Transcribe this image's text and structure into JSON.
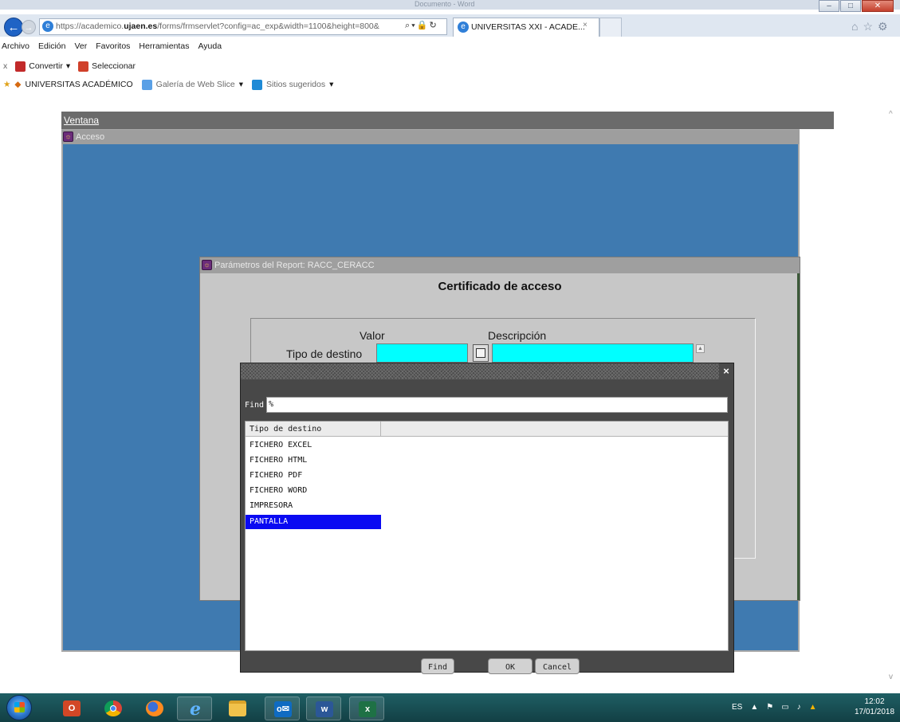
{
  "browser": {
    "title_faded": "Documento - Word",
    "address_url": "https://academico.ujaen.es/forms/frmservlet?config=ac_exp&width=1100&height=800&",
    "address_domain": "ujaen.es",
    "tab_title": "UNIVERSITAS XXI - ACADE...",
    "tab_close": "×",
    "menu": [
      "Archivo",
      "Edición",
      "Ver",
      "Favoritos",
      "Herramientas",
      "Ayuda"
    ],
    "toolbar": {
      "close_x": "x",
      "convert_label": "Convertir",
      "select_label": "Seleccionar"
    },
    "favorites": {
      "site": "UNIVERSITAS ACADÉMICO",
      "gallery": "Galería de Web Slice",
      "suggested": "Sitios sugeridos"
    }
  },
  "forms": {
    "menu_ventana": "Ventana",
    "window_title": "Acceso"
  },
  "params_dialog": {
    "title": "Parámetros del Report: RACC_CERACC",
    "heading": "Certificado de acceso",
    "col_valor": "Valor",
    "col_descripcion": "Descripción",
    "field_label": "Tipo de destino"
  },
  "lov_dialog": {
    "close": "×",
    "find_label": "Find",
    "find_value": "%",
    "column_header": "Tipo de destino",
    "rows": [
      "FICHERO EXCEL",
      "FICHERO HTML",
      "FICHERO PDF",
      "FICHERO WORD",
      "IMPRESORA",
      "PANTALLA"
    ],
    "selected_row": "PANTALLA",
    "buttons": {
      "find": "Find",
      "ok": "OK",
      "cancel": "Cancel"
    }
  },
  "taskbar": {
    "tray_lang": "ES",
    "time": "12:02",
    "date": "17/01/2018"
  },
  "colors": {
    "forms_blue": "#3f7ab0",
    "field_cyan": "#00ffff",
    "selection_blue": "#0a0af2"
  }
}
